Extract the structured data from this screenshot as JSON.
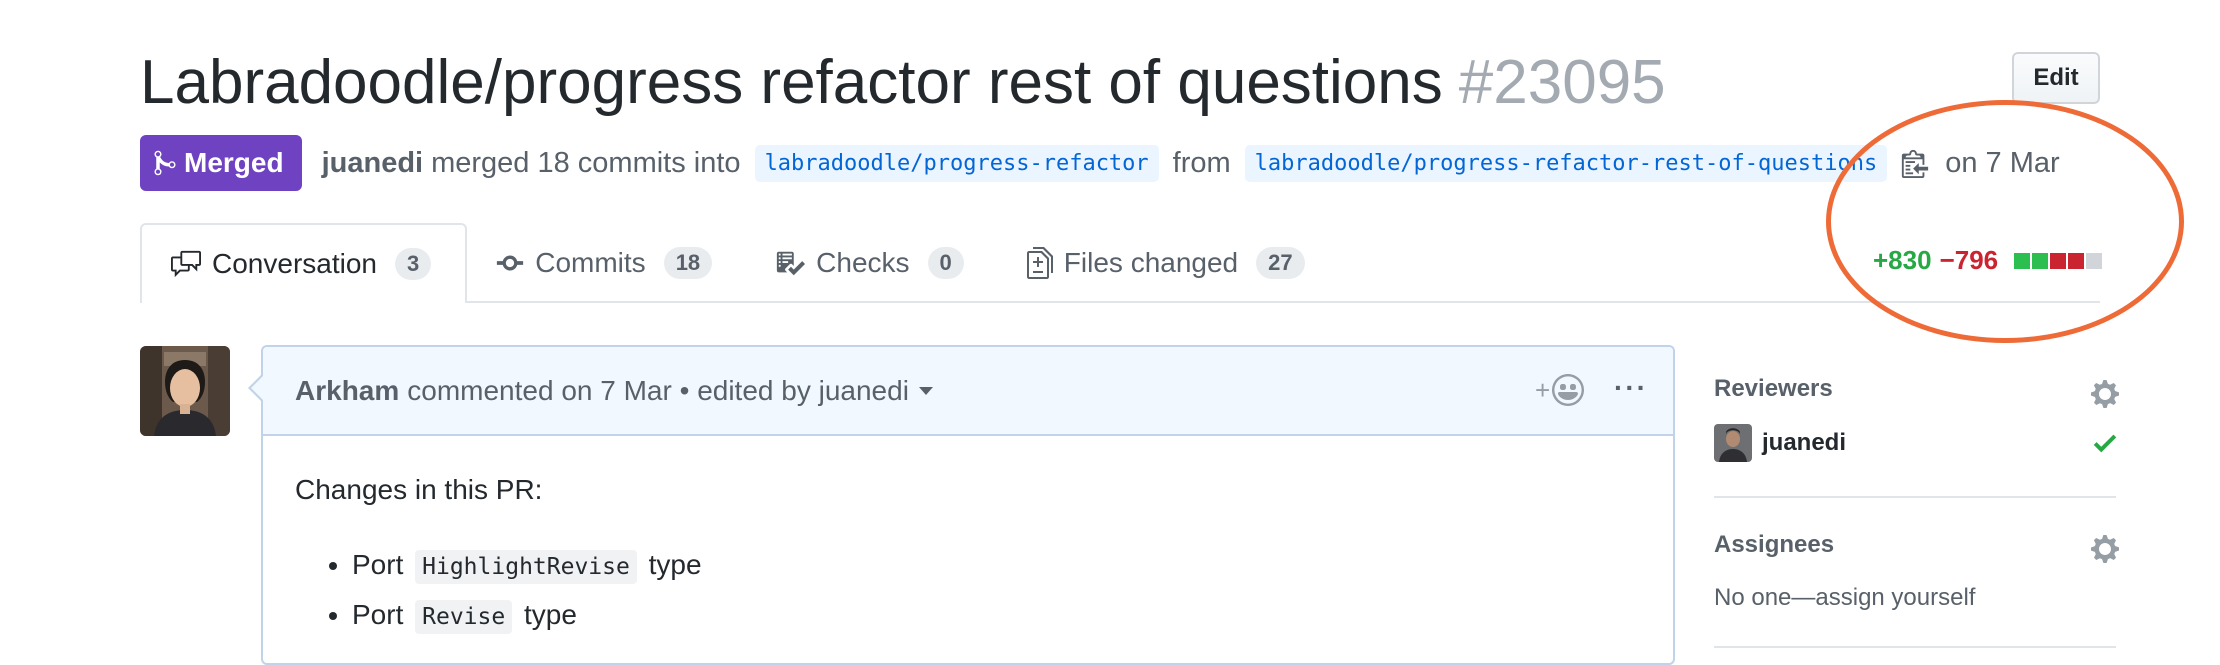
{
  "pr": {
    "title": "Labradoodle/progress refactor rest of questions",
    "number": "#23095",
    "edit_label": "Edit",
    "state": "Merged",
    "author": "juanedi",
    "merge_text": "merged 18 commits into",
    "base_branch": "labradoodle/progress-refactor",
    "from_text": "from",
    "head_branch": "labradoodle/progress-refactor-rest-of-questions",
    "date_text": "on 7 Mar"
  },
  "tabs": [
    {
      "label": "Conversation",
      "count": "3",
      "icon": "comment-discussion-icon"
    },
    {
      "label": "Commits",
      "count": "18",
      "icon": "git-commit-icon"
    },
    {
      "label": "Checks",
      "count": "0",
      "icon": "checklist-icon"
    },
    {
      "label": "Files changed",
      "count": "27",
      "icon": "diff-icon"
    }
  ],
  "diffstat": {
    "additions": "+830",
    "deletions": "−796",
    "blocks": [
      "#2cbe4e",
      "#2cbe4e",
      "#cb2431",
      "#cb2431",
      "#d1d5da"
    ]
  },
  "comment": {
    "author": "Arkham",
    "meta": "commented on 7 Mar • edited by juanedi",
    "react_label": "+",
    "more_label": "···",
    "intro": "Changes in this PR:",
    "items": [
      {
        "prefix": "Port",
        "code": "HighlightRevise",
        "suffix": "type"
      },
      {
        "prefix": "Port",
        "code": "Revise",
        "suffix": "type"
      }
    ]
  },
  "sidebar": {
    "reviewers_heading": "Reviewers",
    "reviewer_name": "juanedi",
    "assignees_heading": "Assignees",
    "assignees_text": "No one—assign yourself"
  },
  "colors": {
    "merged": "#6f42c1",
    "link": "#0366d6",
    "add": "#28a745",
    "delete": "#cb2431",
    "annotation": "#ee6b38"
  }
}
